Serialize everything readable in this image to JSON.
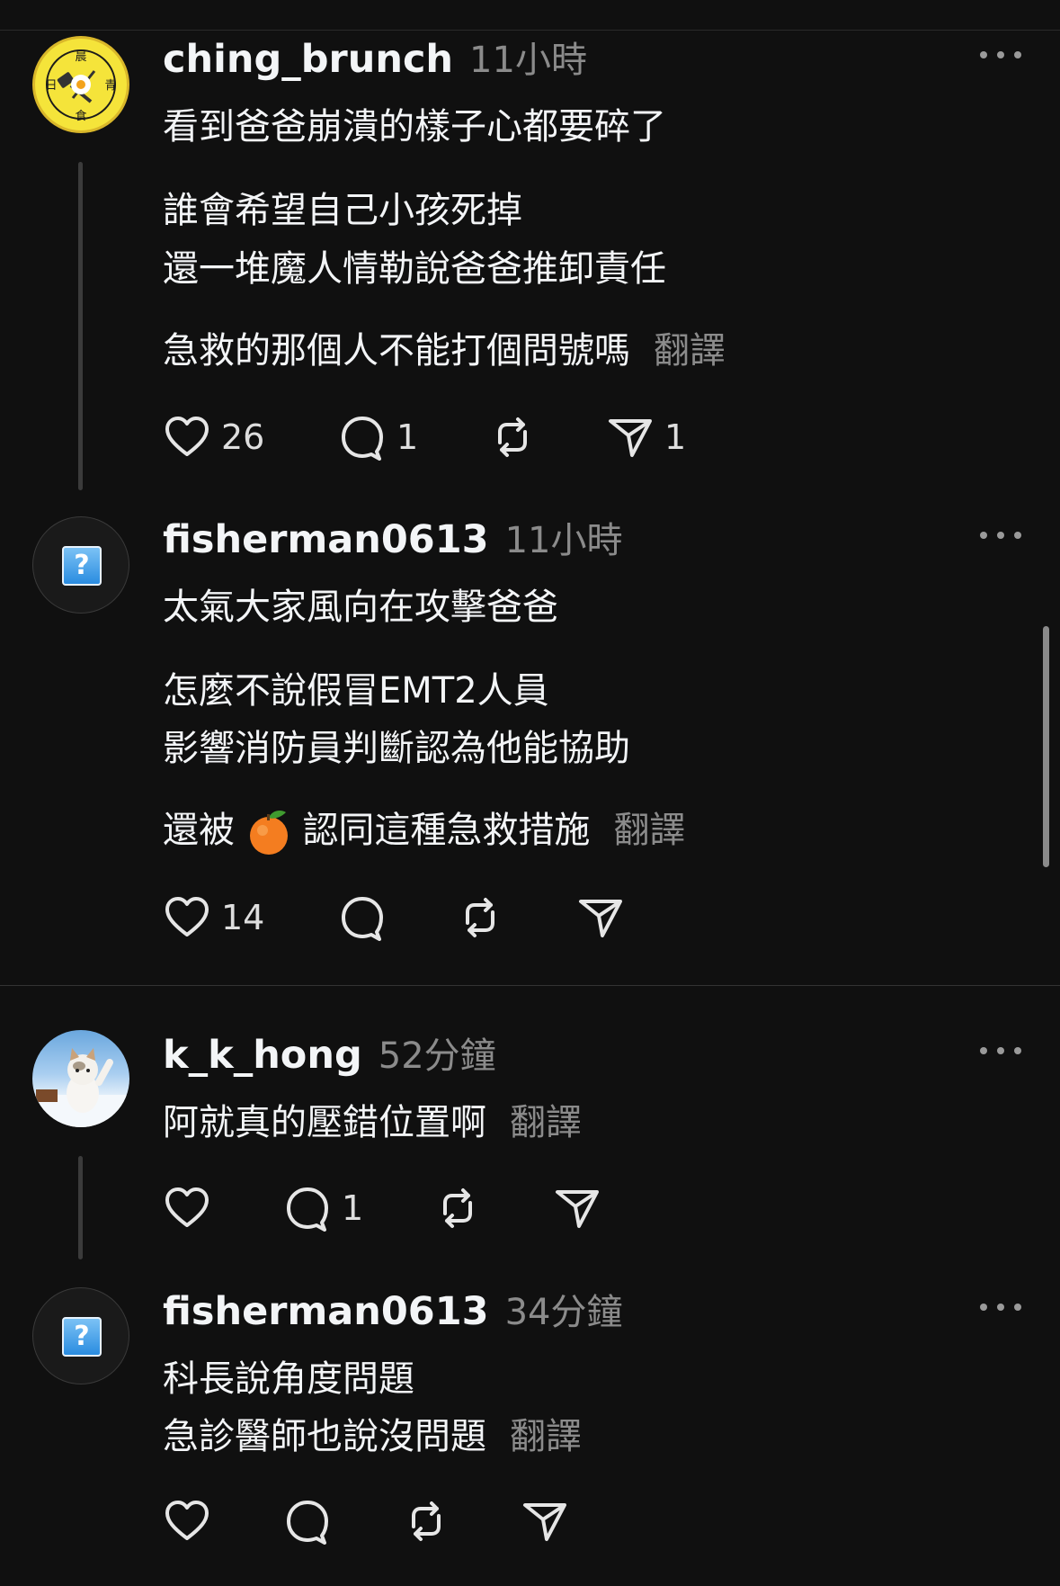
{
  "posts": [
    {
      "username": "ching_brunch",
      "time": "11小時",
      "avatar_chars": [
        "晨",
        "日",
        "青",
        "食"
      ],
      "lines": [
        "看到爸爸崩潰的樣子心都要碎了",
        "誰會希望自己小孩死掉",
        "還一堆魔人情勒說爸爸推卸責任",
        "急救的那個人不能打個問號嗎"
      ],
      "translate": "翻譯",
      "likes": "26",
      "comments": "1",
      "shares": "1"
    },
    {
      "username": "fisherman0613",
      "time": "11小時",
      "avatar_glyph": "?",
      "lines": [
        "太氣大家風向在攻擊爸爸",
        "怎麼不說假冒EMT2人員",
        "影響消防員判斷認為他能協助",
        "還被",
        "認同這種急救措施"
      ],
      "translate": "翻譯",
      "likes": "14"
    },
    {
      "username": "k_k_hong",
      "time": "52分鐘",
      "lines": [
        "阿就真的壓錯位置啊"
      ],
      "translate": "翻譯",
      "comments": "1"
    },
    {
      "username": "fisherman0613",
      "time": "34分鐘",
      "avatar_glyph": "?",
      "lines": [
        "科長說角度問題",
        "急診醫師也說沒問題"
      ],
      "translate": "翻譯"
    }
  ],
  "icons": [
    "heart-icon",
    "comment-icon",
    "repost-icon",
    "share-icon",
    "more-icon",
    "orange-emoji-icon"
  ],
  "colors": {
    "background": "#101010",
    "text": "#f3f5f7",
    "muted": "#8b8b8b"
  }
}
